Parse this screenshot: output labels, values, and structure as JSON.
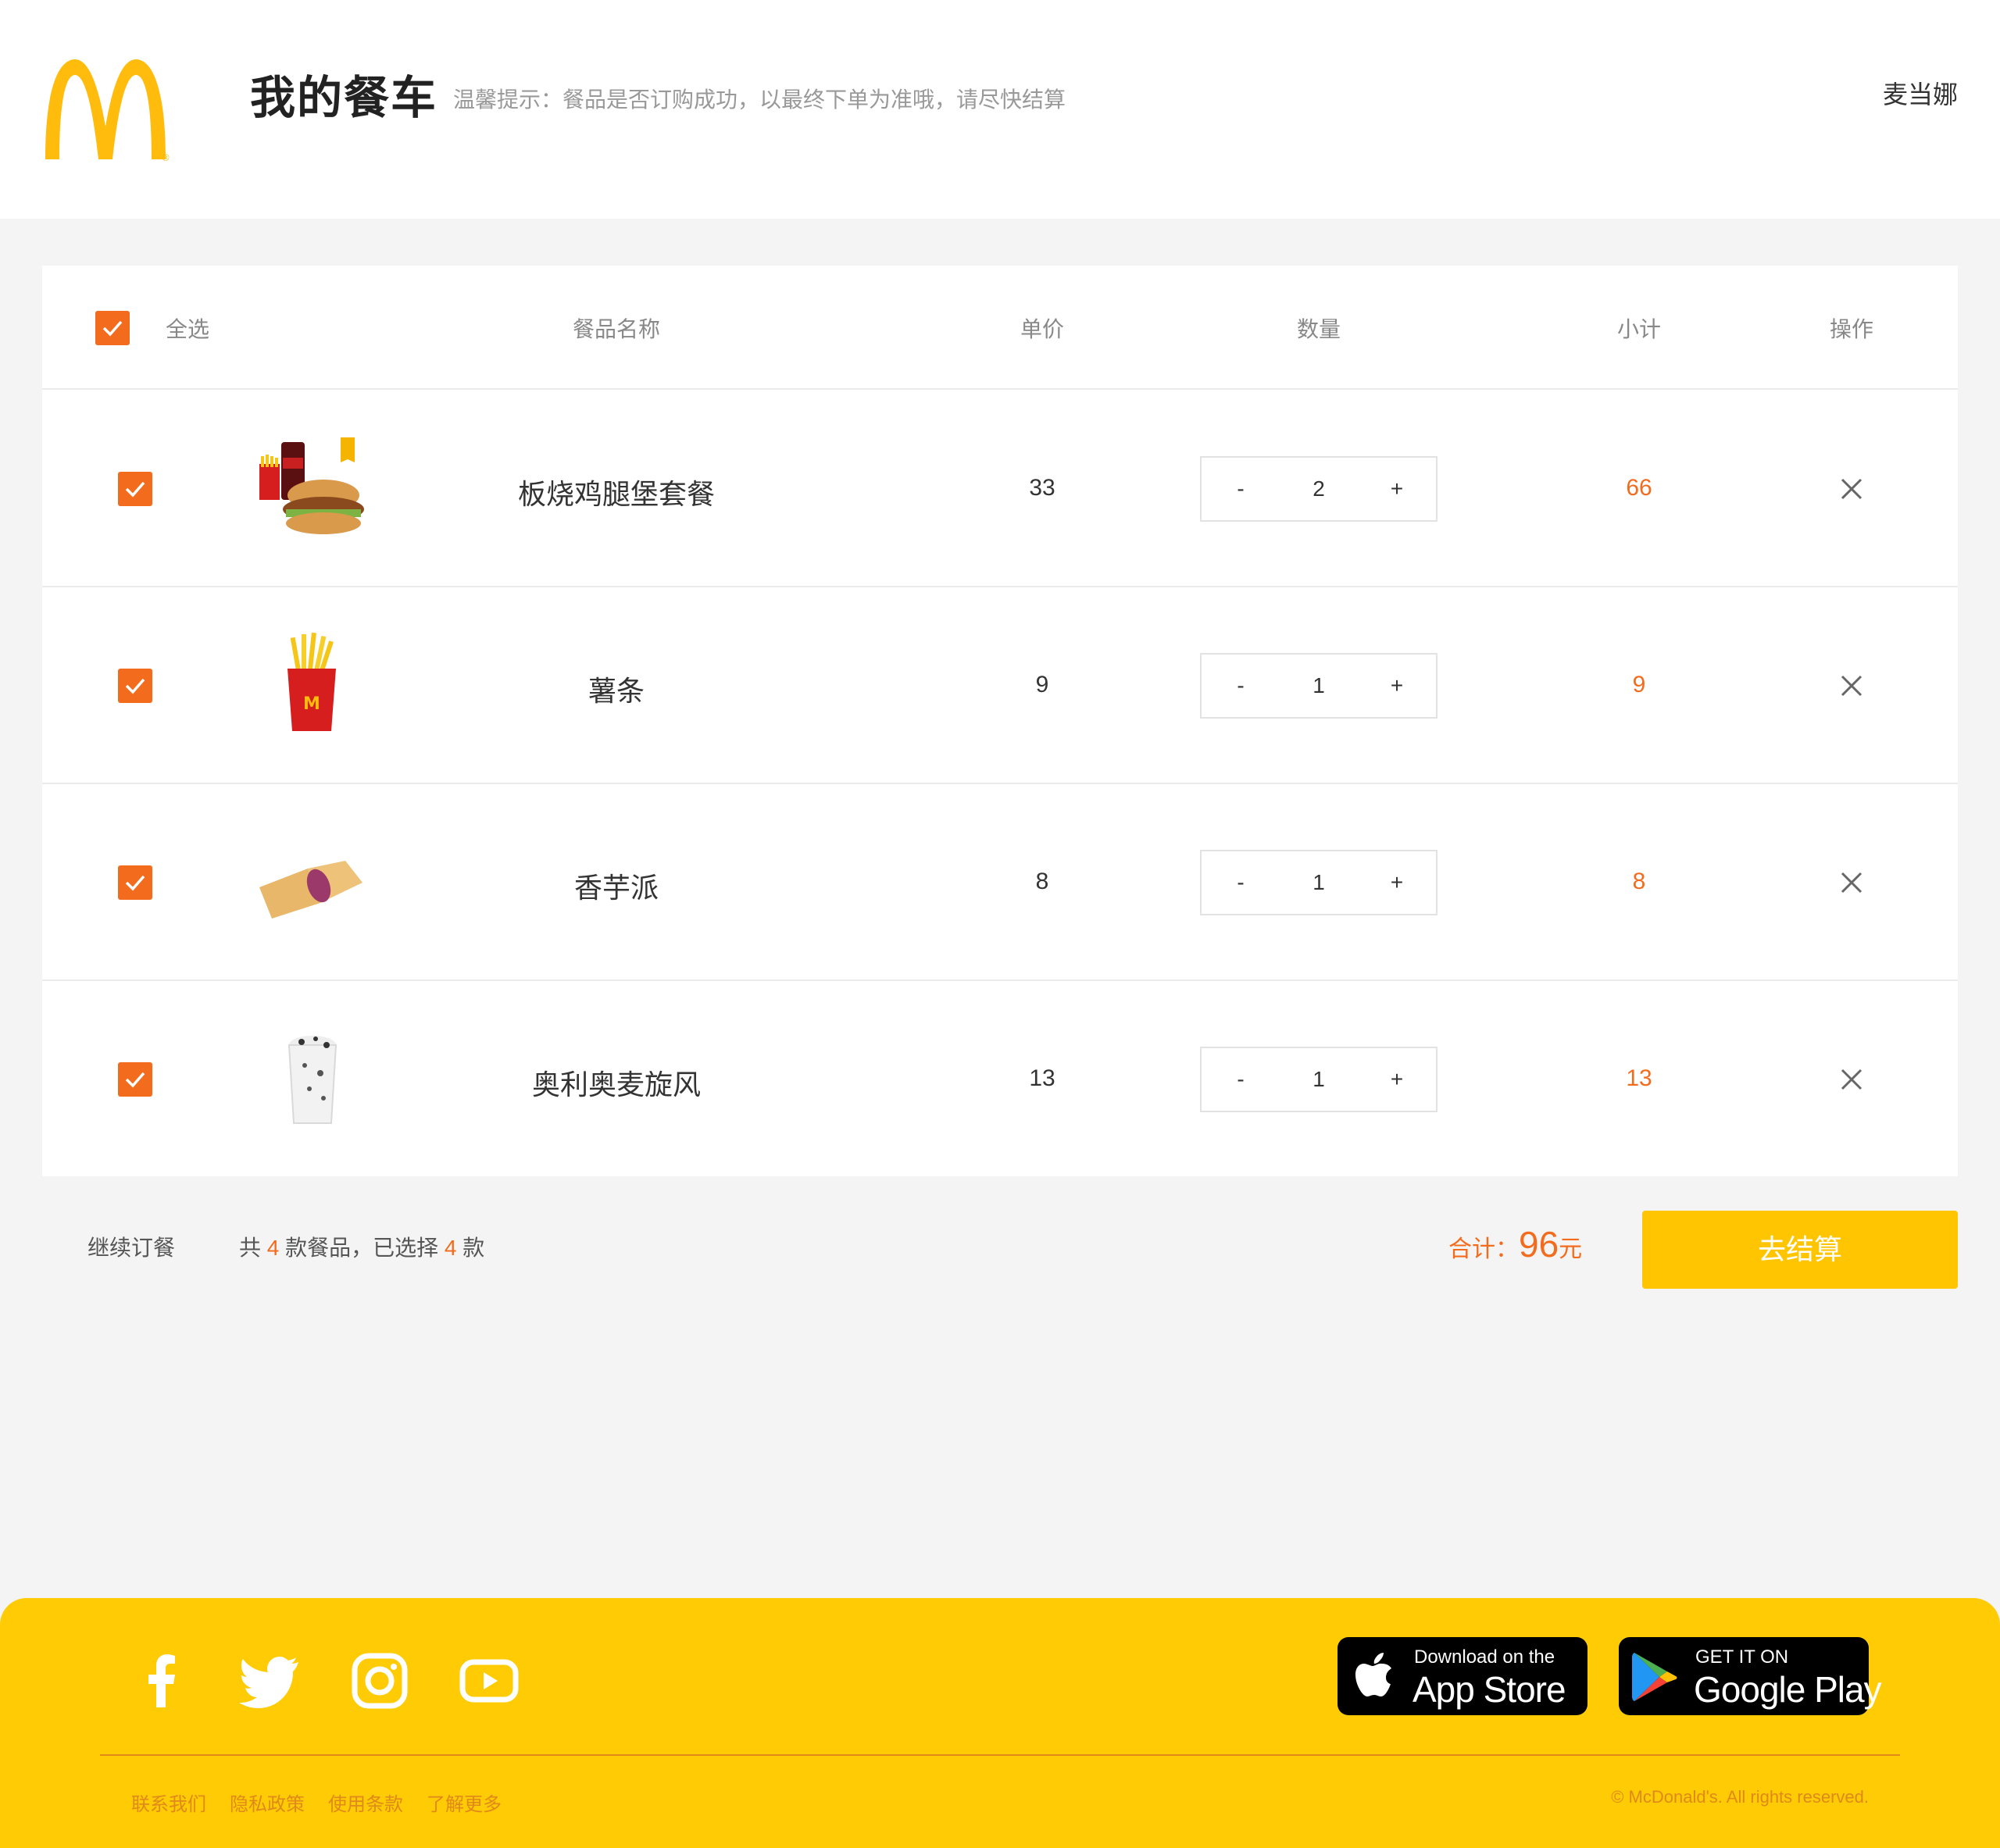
{
  "header": {
    "brand_icon": "mcdonalds-golden-arches-logo",
    "title": "我的餐车",
    "tip": "温馨提示：餐品是否订购成功，以最终下单为准哦，请尽快结算",
    "user_name": "麦当娜"
  },
  "cart": {
    "columns": {
      "select_all": "全选",
      "name": "餐品名称",
      "price": "单价",
      "quantity": "数量",
      "subtotal": "小计",
      "action": "操作"
    },
    "select_all_checked": true,
    "items": [
      {
        "name": "板烧鸡腿堡套餐",
        "price": "33",
        "quantity": "2",
        "subtotal": "66",
        "checked": true,
        "image": "chicken-burger-combo-image"
      },
      {
        "name": "薯条",
        "price": "9",
        "quantity": "1",
        "subtotal": "9",
        "checked": true,
        "image": "french-fries-image"
      },
      {
        "name": "香芋派",
        "price": "8",
        "quantity": "1",
        "subtotal": "8",
        "checked": true,
        "image": "taro-pie-image"
      },
      {
        "name": "奥利奥麦旋风",
        "price": "13",
        "quantity": "1",
        "subtotal": "13",
        "checked": true,
        "image": "oreo-mcflurry-image"
      }
    ],
    "minus_label": "-",
    "plus_label": "+"
  },
  "summary": {
    "continue_label": "继续订餐",
    "count_prefix": "共 ",
    "total_count": "4",
    "count_middle": " 款餐品，已选择 ",
    "selected_count": "4",
    "count_suffix": " 款",
    "total_label": "合计：",
    "total_value": "96",
    "total_unit": "元",
    "checkout_label": "去结算"
  },
  "footer": {
    "social_icons": [
      "facebook-icon",
      "twitter-icon",
      "instagram-icon",
      "youtube-icon"
    ],
    "app_store": {
      "small": "Download on the",
      "big": "App Store"
    },
    "google_play": {
      "small": "GET IT ON",
      "big": "Google Play"
    },
    "links": [
      "联系我们",
      "隐私政策",
      "使用条款",
      "了解更多"
    ],
    "copyright": "© McDonald's. All rights reserved."
  },
  "colors": {
    "accent_orange": "#f36b1c",
    "brand_yellow": "#ffc500",
    "footer_yellow": "#ffcb05",
    "footer_text": "#e0891a"
  }
}
